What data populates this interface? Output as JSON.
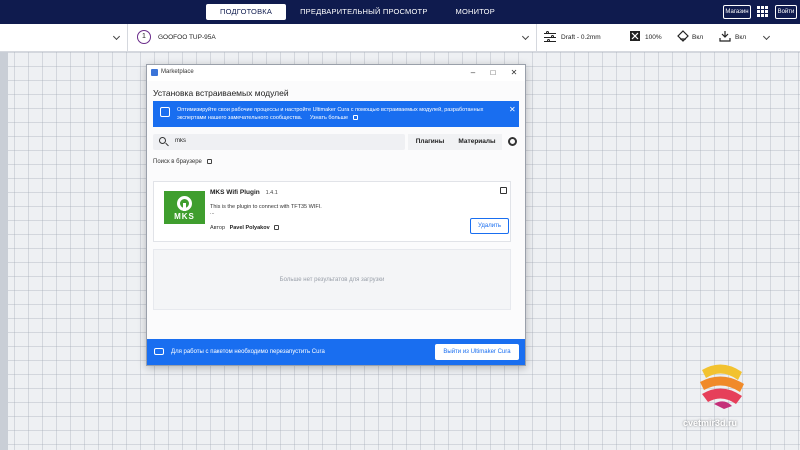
{
  "header": {
    "tabs": [
      {
        "label": "ПОДГОТОВКА",
        "active": true
      },
      {
        "label": "ПРЕДВАРИТЕЛЬНЫЙ ПРОСМОТР",
        "active": false
      },
      {
        "label": "МОНИТОР",
        "active": false
      }
    ],
    "marketplace_label": "Магазин",
    "apps_icon": "apps-grid-icon",
    "login_label": "Войти"
  },
  "toolbar": {
    "printer_number": "1",
    "printer_name": "GOOFOO TUP-95A",
    "profile": "Draft - 0.2mm",
    "infill": "100%",
    "support": "Вкл",
    "adhesion": "Вкл"
  },
  "dialog": {
    "window_title": "Marketplace",
    "heading": "Установка встраиваемых модулей",
    "banner": {
      "text": "Оптимизируйте свои рабочие процессы и настройте Ultimaker Cura с помощью встраиваемых модулей, разработанных экспертами нашего замечательного сообщества.",
      "link": "Узнать больше"
    },
    "search": {
      "value": "mks"
    },
    "tabs": [
      "Плагины",
      "Материалы"
    ],
    "browser_link": "Поиск в браузере",
    "plugin": {
      "logo_text": "MKS",
      "name": "MKS Wifi Plugin",
      "version": "1.4.1",
      "description": "This is the plugin to connect with TFT35 WIFI.",
      "ellipsis": "...",
      "author_label": "Автор",
      "author": "Pavel Polyakov",
      "action": "Удалить"
    },
    "no_results": "Больше нет результатов для загрузки",
    "footer": {
      "text": "Для работы с пакетом необходимо перезапустить Cura",
      "button": "Выйти из Ultimaker Cura"
    }
  },
  "watermark": {
    "text": "cvetmir3d.ru"
  },
  "colors": {
    "navy": "#0f1b4e",
    "accent": "#196ef0",
    "plugin_green": "#3f9e2e"
  }
}
